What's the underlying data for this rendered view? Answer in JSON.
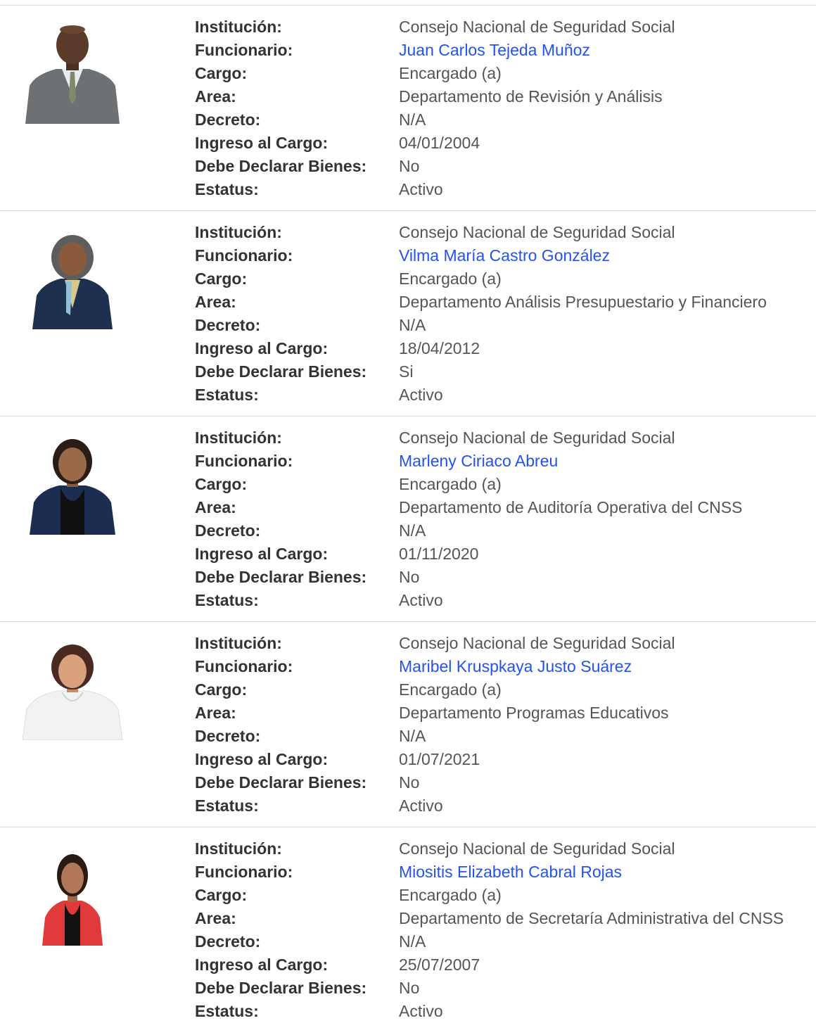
{
  "labels": {
    "institucion": "Institución:",
    "funcionario": "Funcionario:",
    "cargo": "Cargo:",
    "area": "Area:",
    "decreto": "Decreto:",
    "ingreso": "Ingreso al Cargo:",
    "declarar": "Debe Declarar Bienes:",
    "estatus": "Estatus:"
  },
  "colors": {
    "link": "#2452f0",
    "divider": "#dcdcdc"
  },
  "officials": [
    {
      "photo_icon": "official-portrait-man-gray-suit",
      "institucion": "Consejo Nacional de Seguridad Social",
      "funcionario": "Juan Carlos Tejeda Muñoz",
      "cargo": "Encargado (a)",
      "area": "Departamento de Revisión y Análisis",
      "decreto": "N/A",
      "ingreso": "04/01/2004",
      "declarar": "No",
      "estatus": "Activo"
    },
    {
      "photo_icon": "official-portrait-woman-navy-blazer",
      "institucion": "Consejo Nacional de Seguridad Social",
      "funcionario": "Vilma María Castro González",
      "cargo": "Encargado (a)",
      "area": "Departamento Análisis Presupuestario y Financiero",
      "decreto": "N/A",
      "ingreso": "18/04/2012",
      "declarar": "Si",
      "estatus": "Activo"
    },
    {
      "photo_icon": "official-portrait-woman-navy-blazer",
      "institucion": "Consejo Nacional de Seguridad Social",
      "funcionario": "Marleny Ciriaco Abreu",
      "cargo": "Encargado (a)",
      "area": "Departamento de Auditoría Operativa del CNSS",
      "decreto": "N/A",
      "ingreso": "01/11/2020",
      "declarar": "No",
      "estatus": "Activo"
    },
    {
      "photo_icon": "official-portrait-woman-white-blouse",
      "institucion": "Consejo Nacional de Seguridad Social",
      "funcionario": "Maribel Kruspkaya Justo Suárez",
      "cargo": "Encargado (a)",
      "area": "Departamento Programas Educativos",
      "decreto": "N/A",
      "ingreso": "01/07/2021",
      "declarar": "No",
      "estatus": "Activo"
    },
    {
      "photo_icon": "official-portrait-woman-red-blazer",
      "institucion": "Consejo Nacional de Seguridad Social",
      "funcionario": "Miositis Elizabeth Cabral Rojas",
      "cargo": "Encargado (a)",
      "area": "Departamento de Secretaría Administrativa del CNSS",
      "decreto": "N/A",
      "ingreso": "25/07/2007",
      "declarar": "No",
      "estatus": "Activo"
    }
  ]
}
